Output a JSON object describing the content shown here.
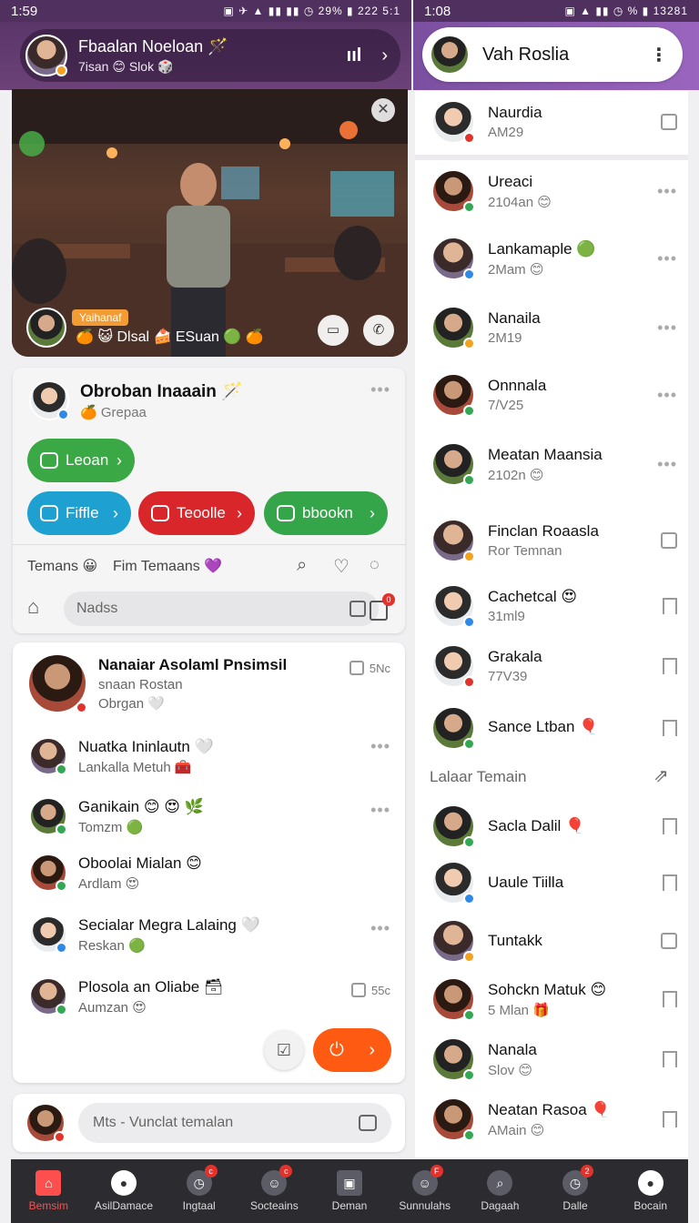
{
  "status_left": {
    "time": "1:59",
    "battery": "29%",
    "extra": "222 5:1"
  },
  "status_right": {
    "time": "1:08",
    "battery": "%",
    "extra": "13281"
  },
  "call": {
    "title": "Fbaalan Noeloan 🪄",
    "subtitle": "7isan 😊 Slok 🎲"
  },
  "video": {
    "badge": "Yaihanaf",
    "line": "🍊 😺 Dlsal 🍰 ESuan 🟢 🍊"
  },
  "card1": {
    "title": "Obroban Inaaain 🪄",
    "subtitle": "🍊 Grepaa",
    "buttons": [
      {
        "label": "Leoan",
        "color": "#3aa845"
      },
      {
        "label": "Fiffle",
        "color": "#1ea0d0"
      },
      {
        "label": "Teoolle",
        "color": "#d9262b"
      },
      {
        "label": "bbookn",
        "color": "#35a54a"
      }
    ],
    "tabs": [
      "Temans 😀",
      "Fim Temaans 💜"
    ],
    "search_placeholder": "Nadss",
    "badge": "0"
  },
  "chats": [
    {
      "name": "Nanaiar Asolaml Pnsimsil",
      "sub": "snaan Rostan",
      "sub2": "Obrgan 🤍",
      "meta": "5Nc"
    },
    {
      "name": "Nuatka Ininlautn 🤍",
      "sub": "Lankalla Metuh 🧰",
      "meta": "•••"
    },
    {
      "name": "Ganikain 😊 😍 🌿",
      "sub": "Tomzm 🟢",
      "meta": "•••"
    },
    {
      "name": "Oboolai Mialan 😊",
      "sub": "Ardlam 😍",
      "meta": ""
    },
    {
      "name": "Secialar Megra Lalaing 🤍",
      "sub": "Reskan 🟢",
      "meta": "•••"
    },
    {
      "name": "Plosola an Oliabe 🗃",
      "sub": "Aumzan 😍",
      "meta": "55c"
    }
  ],
  "compose_placeholder": "Mts - Vunclat temalan",
  "right_header": {
    "title": "Vah Roslia"
  },
  "contacts": [
    {
      "name": "Naurdia",
      "sub": "AM29"
    },
    {
      "name": "Ureaci",
      "sub": "2104an 😊"
    },
    {
      "name": "Lankamaple 🟢",
      "sub": "2Mam 😊"
    },
    {
      "name": "Nanaila",
      "sub": "2M19"
    },
    {
      "name": "Onnnala",
      "sub": "7/V25"
    },
    {
      "name": "Meatan Maansia",
      "sub": "2102n 😊"
    },
    {
      "name": "Finclan Roaasla",
      "sub": "Ror Temnan"
    },
    {
      "name": "Cachetcal 😍",
      "sub": "31ml9"
    },
    {
      "name": "Grakala",
      "sub": "77V39"
    },
    {
      "name": "Sance Ltban 🎈",
      "sub": ""
    }
  ],
  "section_label": "Lalaar Temain",
  "contacts2": [
    {
      "name": "Sacla Dalil 🎈",
      "sub": ""
    },
    {
      "name": "Uaule Tiilla",
      "sub": ""
    },
    {
      "name": "Tuntakk",
      "sub": ""
    },
    {
      "name": "Sohckn Matuk 😊",
      "sub": "5 Mlan 🎁"
    },
    {
      "name": "Nanala",
      "sub": "Slov 😊"
    },
    {
      "name": "Neatan Rasoa 🎈",
      "sub": "AMain 😊"
    }
  ],
  "nav": [
    {
      "label": "Bemsim",
      "active": true,
      "badge": ""
    },
    {
      "label": "AsilDamace",
      "badge": ""
    },
    {
      "label": "Ingtaal",
      "badge": "c"
    },
    {
      "label": "Socteains",
      "badge": "c"
    },
    {
      "label": "Deman",
      "badge": ""
    },
    {
      "label": "Sunnulahs",
      "badge": "F"
    },
    {
      "label": "Dagaah",
      "badge": ""
    },
    {
      "label": "Dalle",
      "badge": "2"
    },
    {
      "label": "Bocain",
      "badge": ""
    }
  ],
  "colors": {
    "accent": "#7b4fa0",
    "send": "#ff5a12"
  }
}
